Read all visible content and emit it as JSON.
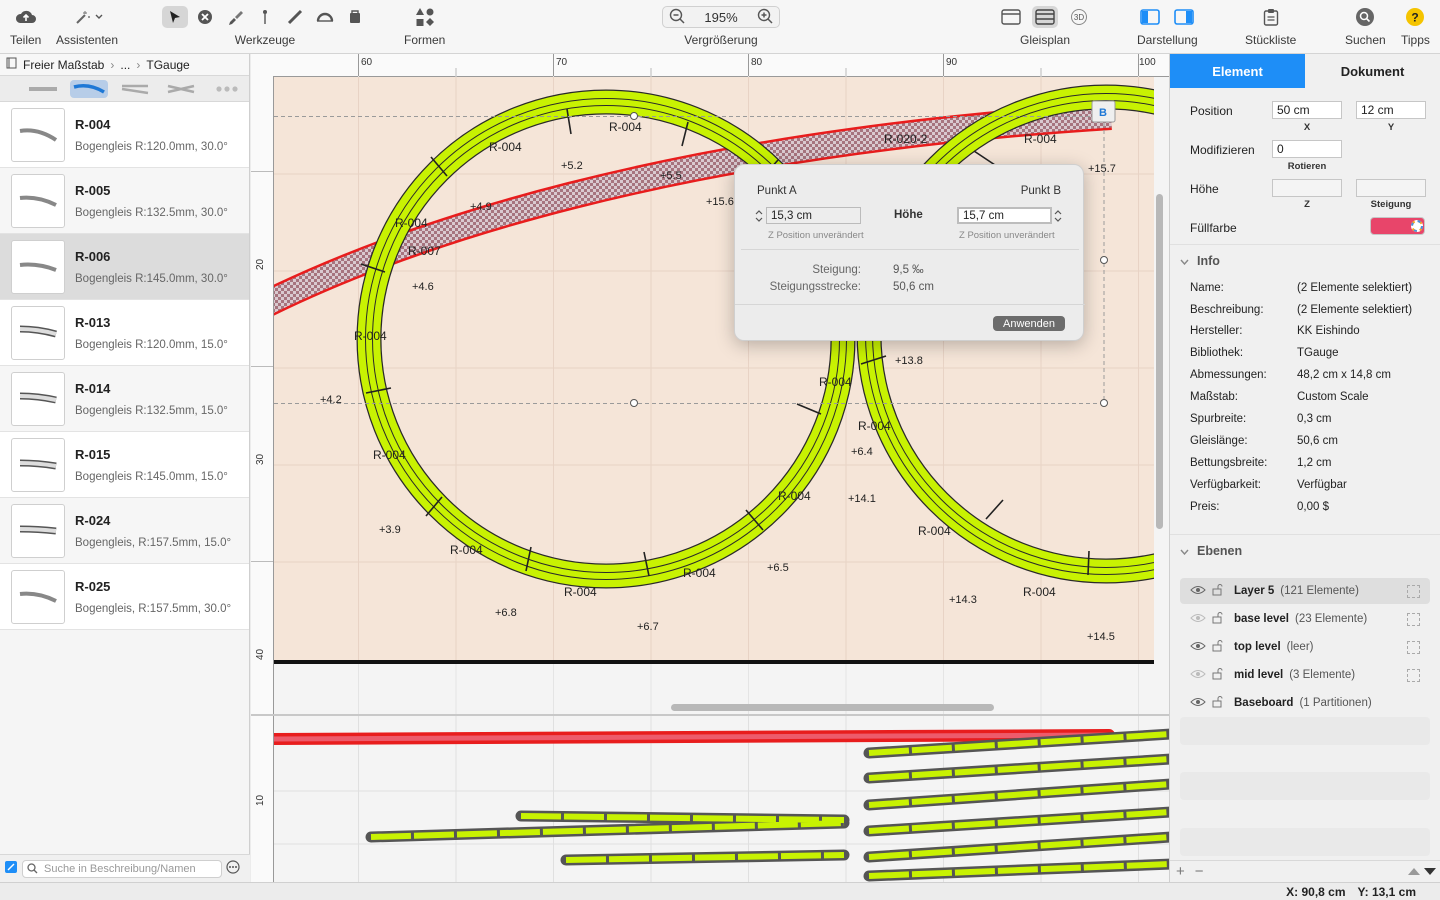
{
  "toolbar": {
    "share": "Teilen",
    "assistants": "Assistenten",
    "tools": "Werkzeuge",
    "shapes": "Formen",
    "zoom": "Vergrößerung",
    "zoom_value": "195%",
    "trackplan": "Gleisplan",
    "view": "Darstellung",
    "parts": "Stückliste",
    "search": "Suchen",
    "tips": "Tipps",
    "view_3d": "3D"
  },
  "breadcrumb": {
    "root": "Freier Maßstab",
    "ellipsis": "...",
    "current": "TGauge"
  },
  "track_list": [
    {
      "name": "R-004",
      "desc": "Bogengleis R:120.0mm, 30.0°"
    },
    {
      "name": "R-005",
      "desc": "Bogengleis R:132.5mm, 30.0°"
    },
    {
      "name": "R-006",
      "desc": "Bogengleis R:145.0mm, 30.0°"
    },
    {
      "name": "R-013",
      "desc": "Bogengleis R:120.0mm, 15.0°"
    },
    {
      "name": "R-014",
      "desc": "Bogengleis R:132.5mm, 15.0°"
    },
    {
      "name": "R-015",
      "desc": "Bogengleis R:145.0mm, 15.0°"
    },
    {
      "name": "R-024",
      "desc": "Bogengleis, R:157.5mm, 15.0°"
    },
    {
      "name": "R-025",
      "desc": "Bogengleis, R:157.5mm, 30.0°"
    }
  ],
  "search": {
    "placeholder": "Suche in Beschreibung/Namen"
  },
  "ruler": {
    "top": [
      "60",
      "70",
      "80",
      "90",
      "100"
    ],
    "left": [
      "20",
      "30",
      "40"
    ],
    "left_bottom": [
      "10"
    ]
  },
  "canvas": {
    "track_labels": [
      "R-004",
      "R-007",
      "R-020-2"
    ],
    "heights": [
      "+5.2",
      "+4.9",
      "+4.6",
      "+4.2",
      "+3.9",
      "+6.8",
      "+6.7",
      "+6.5",
      "+5.5",
      "+15.6",
      "+15.7",
      "+13.8",
      "+6.4",
      "+14.1",
      "+14.3",
      "+14.5"
    ],
    "marker_b": "B",
    "colors": {
      "board": "#f5e5d8",
      "track": "#c8f202",
      "selected": "#e02020"
    }
  },
  "popover": {
    "point_a": "Punkt A",
    "point_b": "Punkt B",
    "height_label": "Höhe",
    "a_value": "15,3 cm",
    "b_value": "15,7 cm",
    "a_hint": "Z Position unverändert",
    "b_hint": "Z Position unverändert",
    "gradient_label": "Steigung:",
    "gradient_value": "9,5 ‰",
    "distance_label": "Steigungsstrecke:",
    "distance_value": "50,6 cm",
    "apply": "Anwenden"
  },
  "inspector": {
    "tab_element": "Element",
    "tab_document": "Dokument",
    "position_label": "Position",
    "pos_x": "50 cm",
    "pos_y": "12 cm",
    "x_label": "X",
    "y_label": "Y",
    "modify_label": "Modifizieren",
    "rotate_value": "0",
    "rotate_label": "Rotieren",
    "height_label": "Höhe",
    "z_label": "Z",
    "slope_label": "Steigung",
    "fill_label": "Füllfarbe",
    "fill_color": "#e8456a",
    "info_section": "Info",
    "info": [
      {
        "k": "Name:",
        "v": "(2 Elemente selektiert)"
      },
      {
        "k": "Beschreibung:",
        "v": "(2 Elemente selektiert)"
      },
      {
        "k": "Hersteller:",
        "v": "KK Eishindo"
      },
      {
        "k": "Bibliothek:",
        "v": "TGauge"
      },
      {
        "k": "Abmessungen:",
        "v": "48,2 cm x 14,8 cm"
      },
      {
        "k": "Maßstab:",
        "v": "Custom Scale"
      },
      {
        "k": "Spurbreite:",
        "v": "0,3 cm"
      },
      {
        "k": "Gleislänge:",
        "v": "50,6 cm"
      },
      {
        "k": "Bettungsbreite:",
        "v": "1,2 cm"
      },
      {
        "k": "Verfügbarkeit:",
        "v": "Verfügbar"
      },
      {
        "k": "Preis:",
        "v": "0,00 $"
      }
    ],
    "layers_section": "Ebenen",
    "layers": [
      {
        "name": "Layer 5",
        "count": "(121 Elemente)"
      },
      {
        "name": "base level",
        "count": "(23 Elemente)"
      },
      {
        "name": "top level",
        "count": "(leer)"
      },
      {
        "name": "mid level",
        "count": "(3 Elemente)"
      },
      {
        "name": "Baseboard",
        "count": "(1 Partitionen)"
      }
    ]
  },
  "status": {
    "x": "X: 90,8 cm",
    "y": "Y: 13,1 cm"
  }
}
